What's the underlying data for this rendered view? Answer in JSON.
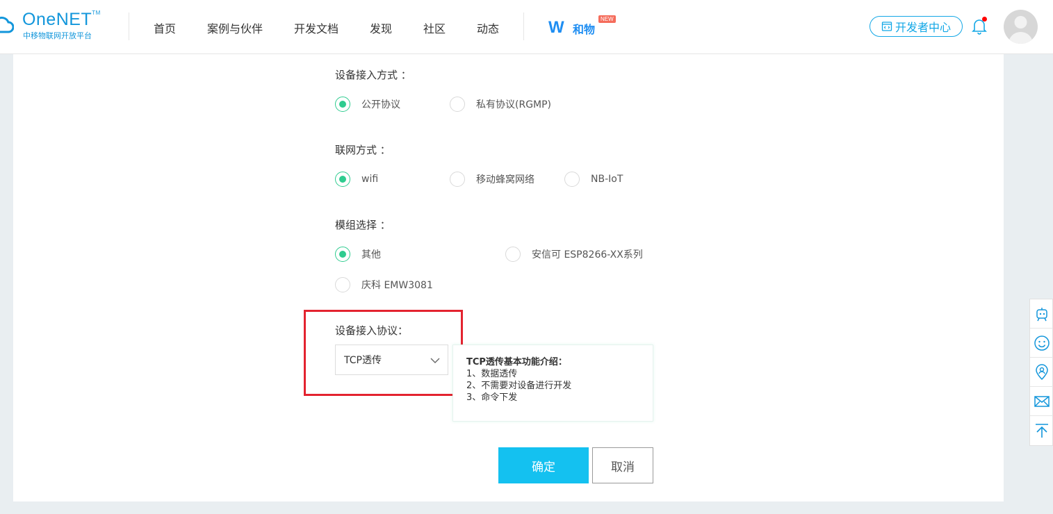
{
  "header": {
    "brand": "OneNET",
    "brand_tm": "TM",
    "brand_sub": "中移物联网开放平台",
    "nav": [
      "首页",
      "案例与伙伴",
      "开发文档",
      "发现",
      "社区",
      "动态"
    ],
    "hewu_text": "和物",
    "hewu_badge": "NEW",
    "dev_center": "开发者中心"
  },
  "form": {
    "access_method": {
      "label": "设备接入方式 ：",
      "options": [
        "公开协议",
        "私有协议(RGMP)"
      ],
      "selected": "公开协议"
    },
    "network": {
      "label": "联网方式 ：",
      "options": [
        "wifi",
        "移动蜂窝网络",
        "NB-IoT"
      ],
      "selected": "wifi"
    },
    "module": {
      "label": "模组选择 ：",
      "options": [
        "其他",
        "安信可 ESP8266-XX系列",
        "庆科 EMW3081"
      ],
      "selected": "其他"
    },
    "protocol": {
      "label": "设备接入协议：",
      "selected": "TCP透传"
    },
    "tip": {
      "title": "TCP透传基本功能介绍：",
      "lines": [
        "1、数据透传",
        "2、不需要对设备进行开发",
        "3、命令下发"
      ]
    },
    "ok": "确定",
    "cancel": "取消"
  },
  "colors": {
    "accent": "#14c1f0",
    "radio_checked": "#2ecc8f",
    "highlight": "#e3232f",
    "brand_blue": "#1296db"
  },
  "float_icons": [
    "robot-icon",
    "smile-icon",
    "location-user-icon",
    "mail-icon",
    "back-to-top-icon"
  ]
}
